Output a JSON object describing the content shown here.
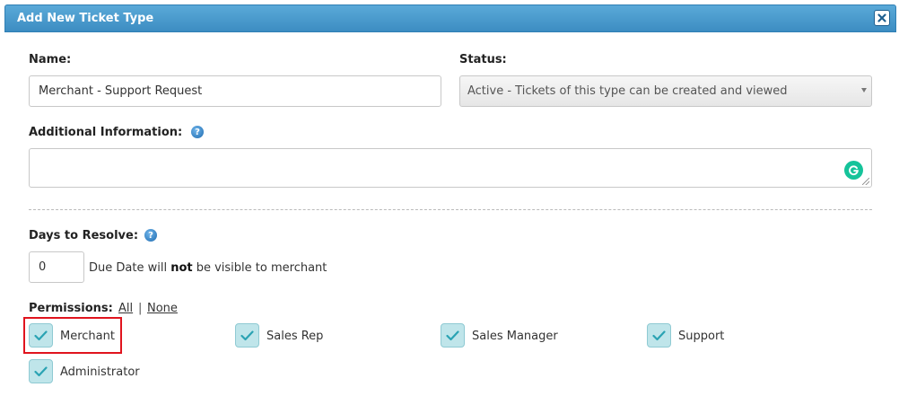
{
  "dialog": {
    "title": "Add New Ticket Type",
    "close_icon": "close-icon"
  },
  "form": {
    "name_label": "Name:",
    "name_value": "Merchant - Support Request",
    "status_label": "Status:",
    "status_value": "Active - Tickets of this type can be created and viewed",
    "additional_label": "Additional Information:",
    "additional_value": "",
    "help_glyph": "?",
    "days_label": "Days to Resolve:",
    "days_value": "0",
    "days_note_pre": "Due Date will ",
    "days_note_bold": "not",
    "days_note_post": " be visible to merchant"
  },
  "permissions": {
    "label": "Permissions:",
    "all_link": "All",
    "separator": "|",
    "none_link": "None",
    "items": [
      {
        "label": "Merchant",
        "checked": true,
        "highlighted": true
      },
      {
        "label": "Sales Rep",
        "checked": true
      },
      {
        "label": "Sales Manager",
        "checked": true
      },
      {
        "label": "Support",
        "checked": true
      },
      {
        "label": "Administrator",
        "checked": true
      }
    ]
  },
  "colors": {
    "titlebar": "#3d8dc2",
    "checkbox_bg": "#bfe5ea",
    "checkmark": "#2aa3b3",
    "highlight": "#e0141e",
    "grammarly": "#15c39a"
  }
}
